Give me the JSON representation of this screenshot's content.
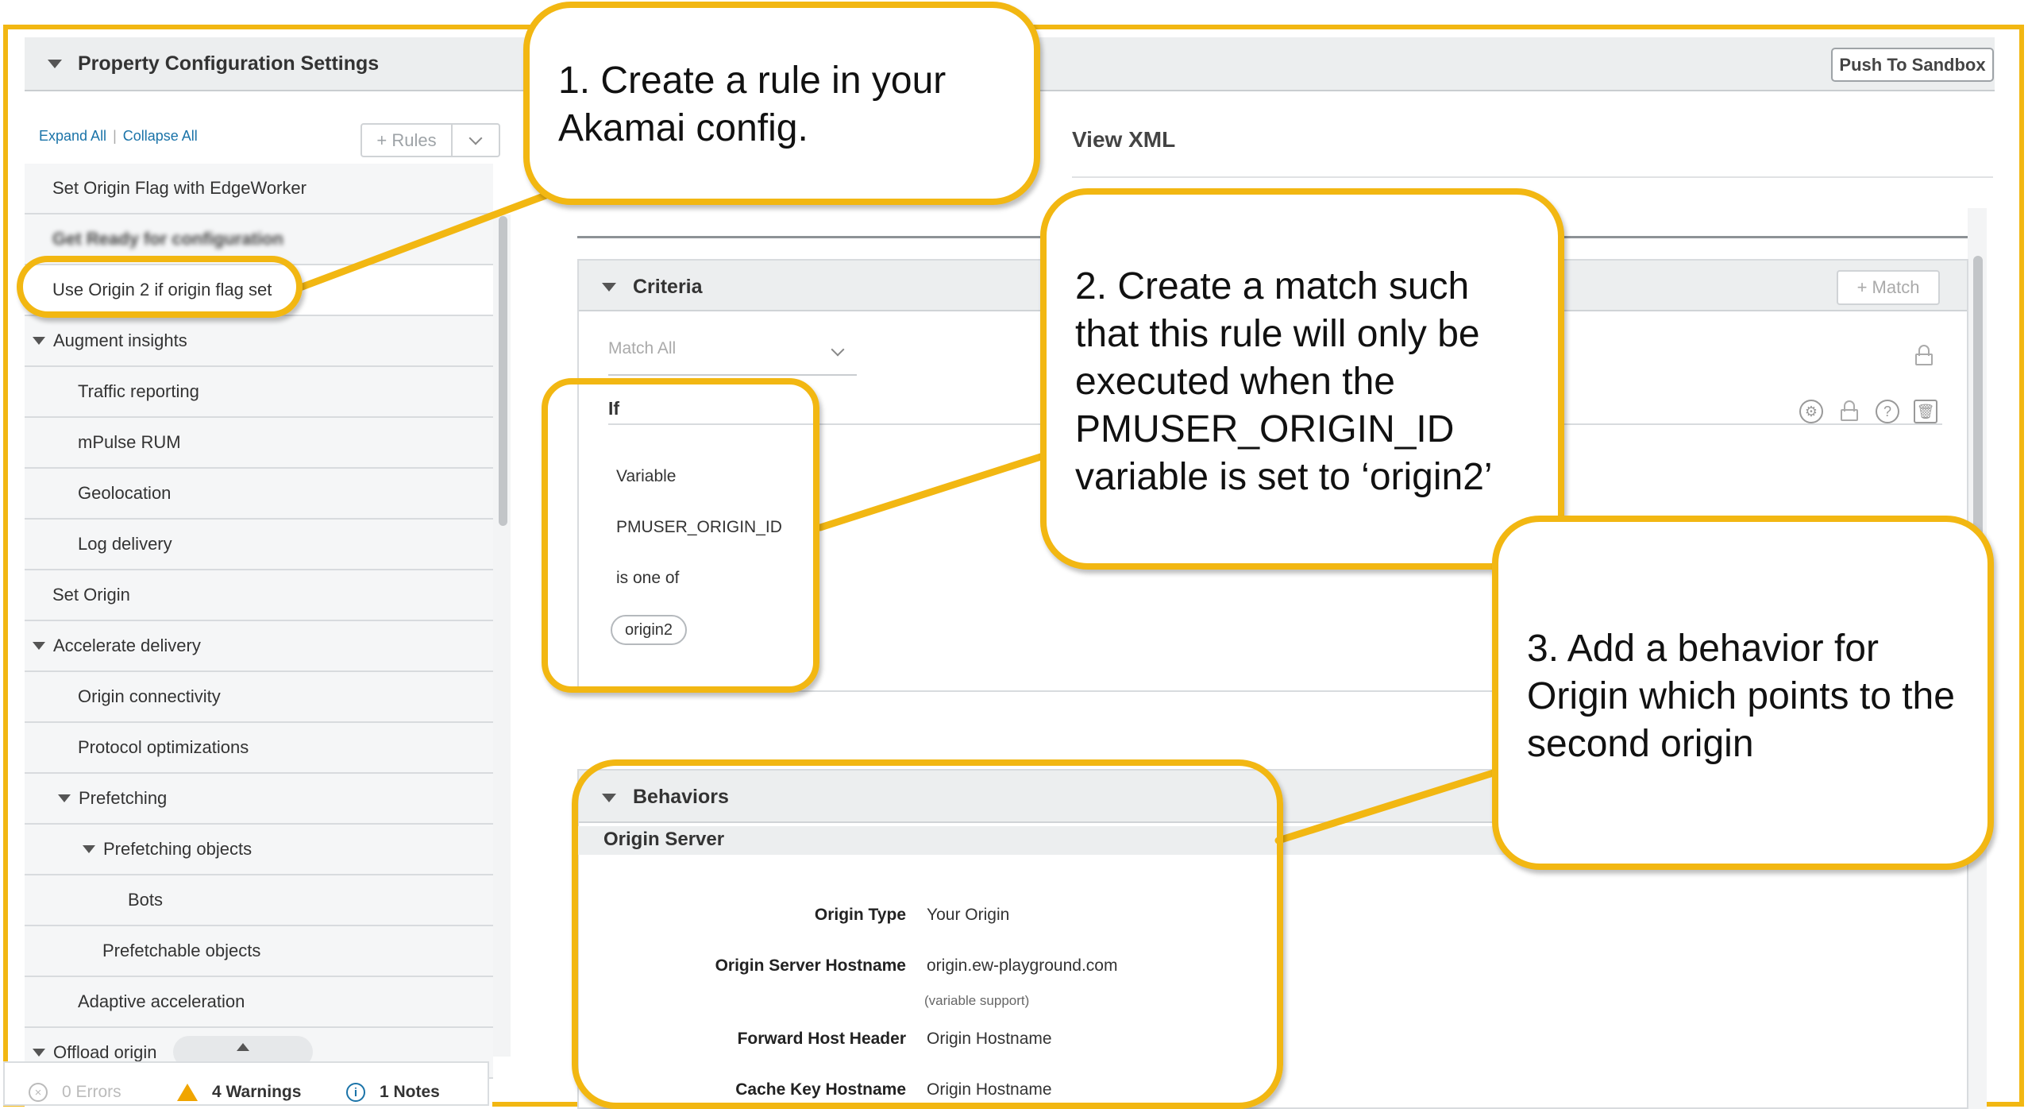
{
  "header": {
    "title": "Property Configuration Settings",
    "push_button": "Push To Sandbox"
  },
  "sidebar": {
    "expand_all": "Expand All",
    "collapse_all": "Collapse All",
    "rules_button": "+ Rules",
    "items": [
      {
        "label": "Set Origin Flag with EdgeWorker"
      },
      {
        "label": "Get Ready for configuration"
      },
      {
        "label": "Use Origin 2 if origin flag set"
      },
      {
        "label": "Augment insights"
      },
      {
        "label": "Traffic reporting"
      },
      {
        "label": "mPulse RUM"
      },
      {
        "label": "Geolocation"
      },
      {
        "label": "Log delivery"
      },
      {
        "label": "Set Origin"
      },
      {
        "label": "Accelerate delivery"
      },
      {
        "label": "Origin connectivity"
      },
      {
        "label": "Protocol optimizations"
      },
      {
        "label": "Prefetching"
      },
      {
        "label": "Prefetching objects"
      },
      {
        "label": "Bots"
      },
      {
        "label": "Prefetchable objects"
      },
      {
        "label": "Adaptive acceleration"
      },
      {
        "label": "Offload origin"
      }
    ]
  },
  "status": {
    "errors": "0 Errors",
    "warnings": "4 Warnings",
    "notes": "1 Notes"
  },
  "main": {
    "view_xml": "View XML",
    "criteria": {
      "title": "Criteria",
      "match_button": "+ Match",
      "match_select": "Match All",
      "if_label": "If",
      "condition_type": "Variable",
      "variable_name": "PMUSER_ORIGIN_ID",
      "operator": "is one of",
      "value_chip": "origin2"
    },
    "behaviors": {
      "title": "Behaviors",
      "origin_server": "Origin Server",
      "fields": [
        {
          "label": "Origin Type",
          "value": "Your Origin"
        },
        {
          "label": "Origin Server Hostname",
          "value": "origin.ew-playground.com",
          "note": "(variable support)"
        },
        {
          "label": "Forward Host Header",
          "value": "Origin Hostname"
        },
        {
          "label": "Cache Key Hostname",
          "value": "Origin Hostname"
        }
      ]
    }
  },
  "callouts": {
    "step1": "1. Create a rule in your Akamai config.",
    "step2": "2. Create a match such that this rule will only be executed when the PMUSER_ORIGIN_ID variable is set to ‘origin2’",
    "step3": "3. Add a behavior for Origin which points to the second origin"
  },
  "colors": {
    "highlight": "#f2b712",
    "link": "#1a73a8",
    "panel_header": "#eceeef",
    "warning": "#f0a500"
  }
}
